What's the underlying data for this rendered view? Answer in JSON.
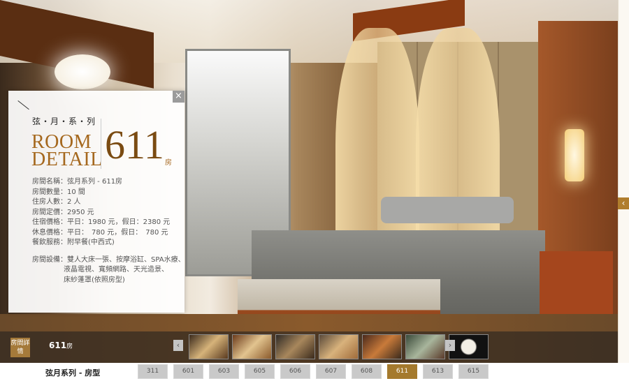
{
  "detail": {
    "series": "弦・月・系・列",
    "title_line1": "ROOM",
    "title_line2": "DETAIL",
    "room_number": "611",
    "room_unit": "房",
    "info": [
      "房間名稱：弦月系列 - 611房",
      "房間數量：10 間",
      "住房人數：2 人",
      "房間定價：2950 元",
      "住宿價格：平日：1980 元，假日：2380 元",
      "休息價格：平日：　780 元，假日：　780 元",
      "餐飲服務：附早餐(中西式)"
    ],
    "equipment_label": "房間設備：",
    "equipment_lines": [
      "雙人大床一張、按摩浴缸、SPA水療、",
      "液晶電視、寬頻網路、天光造景、",
      "床紗蓬罩(依照房型)"
    ]
  },
  "strip": {
    "category": "房間詳情",
    "room_label": "611",
    "room_unit": "房",
    "prev": "‹",
    "next": "›",
    "thumbnail_count": 7
  },
  "edge_tab": "‹",
  "close": "×",
  "bottom": {
    "label": "弦月系列 - 房型",
    "tabs": [
      "311",
      "601",
      "603",
      "605",
      "606",
      "607",
      "608",
      "611",
      "613",
      "615"
    ],
    "active": "611"
  },
  "colors": {
    "accent": "#a57a2d",
    "title_gold": "#a5681e",
    "number_brown": "#7a4b12"
  }
}
